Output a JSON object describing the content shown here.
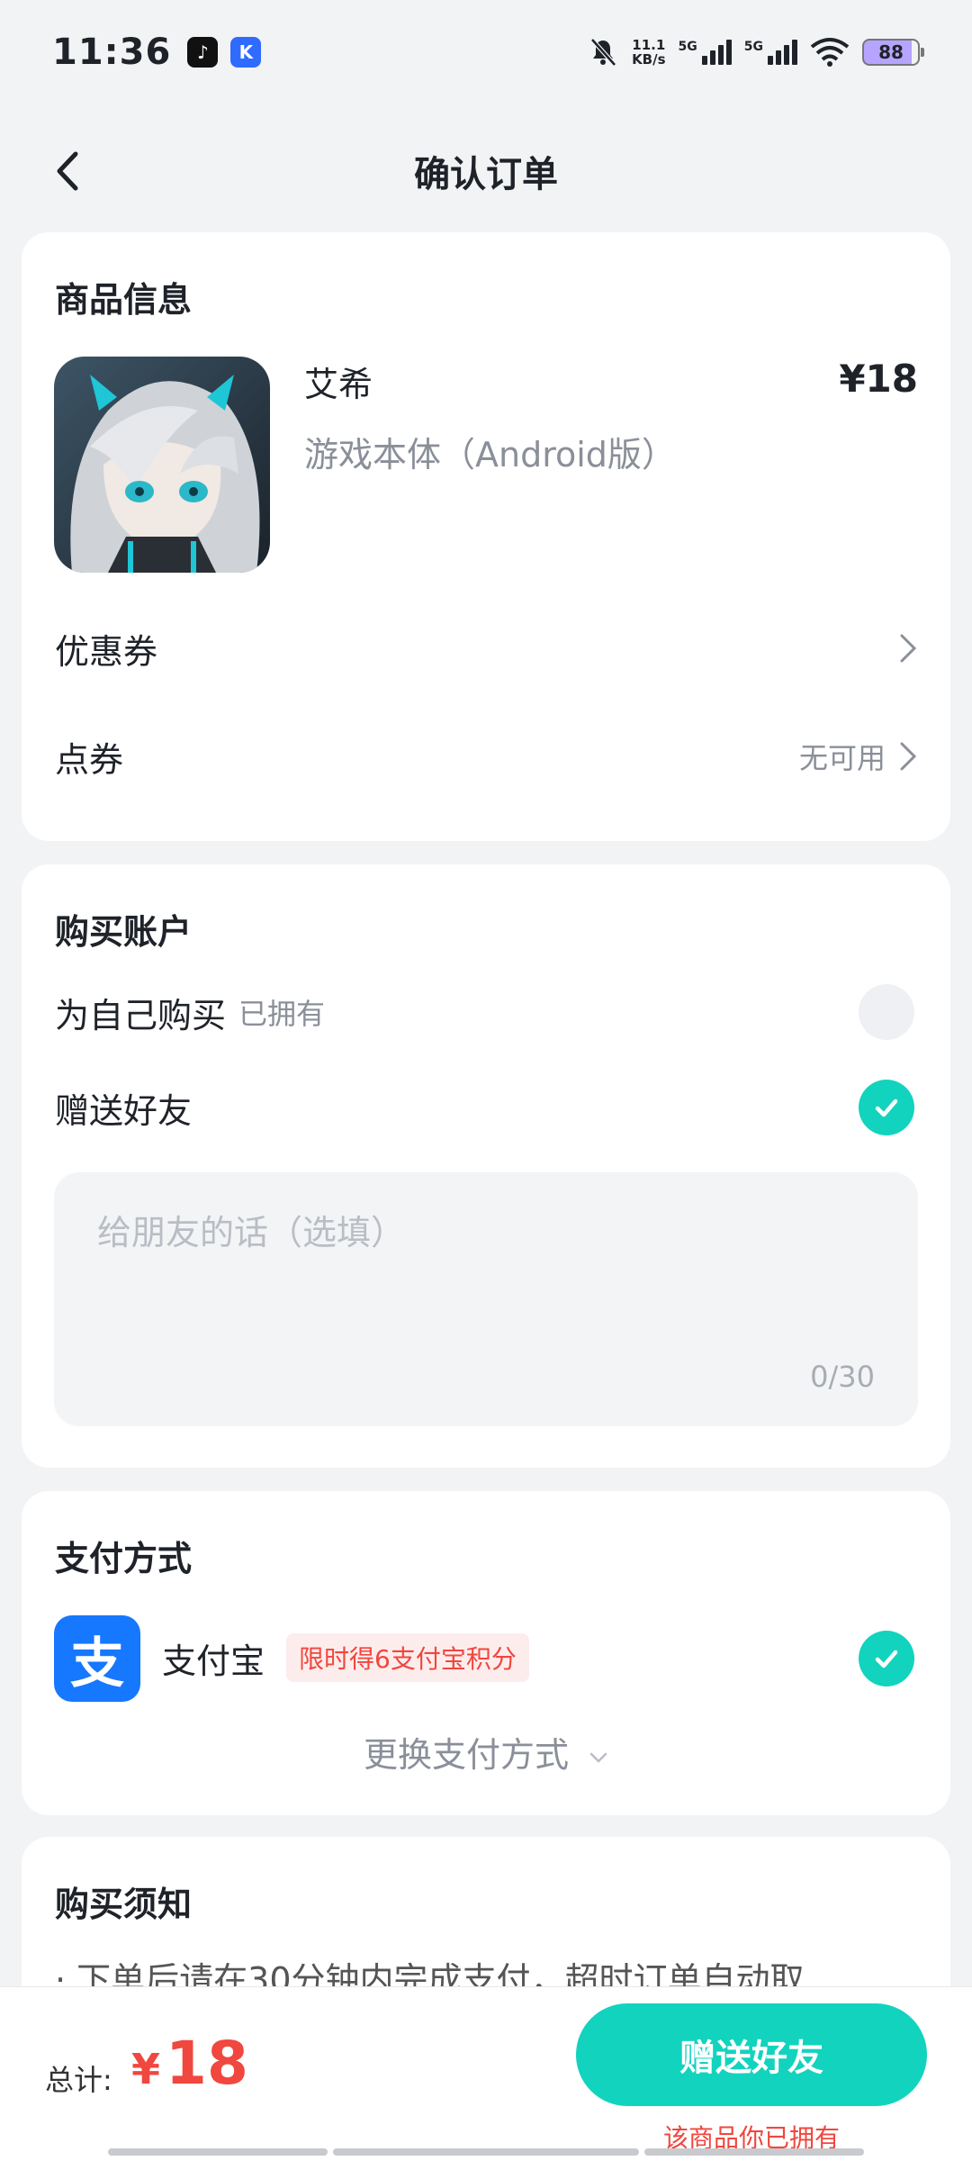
{
  "status_bar": {
    "time": "11:36",
    "net_speed_value": "11.1",
    "net_speed_unit": "KB/s",
    "sim1": "5G",
    "sim2": "5G",
    "battery": "88"
  },
  "header": {
    "title": "确认订单"
  },
  "product_card": {
    "section_title": "商品信息",
    "name": "艾希",
    "price": "¥18",
    "subtitle": "游戏本体（Android版）",
    "coupon_label": "优惠券",
    "points_label": "点券",
    "points_value": "无可用"
  },
  "account_card": {
    "section_title": "购买账户",
    "self_label": "为自己购买",
    "self_tag": "已拥有",
    "gift_label": "赠送好友",
    "message_placeholder": "给朋友的话（选填）",
    "message_count": "0/30"
  },
  "payment_card": {
    "section_title": "支付方式",
    "alipay_logo": "支",
    "method_name": "支付宝",
    "promo": "限时得6支付宝积分",
    "change_label": "更换支付方式"
  },
  "notice_card": {
    "section_title": "购买须知",
    "line1": "· 下单后请在30分钟内完成支付，超时订单自动取"
  },
  "bottom_bar": {
    "total_label": "总计:",
    "currency": "¥",
    "total_value": "18",
    "action_label": "赠送好友",
    "owned_note": "该商品你已拥有"
  },
  "colors": {
    "accent": "#12d3be",
    "price_red": "#f0473e",
    "alipay_blue": "#1677ff"
  }
}
